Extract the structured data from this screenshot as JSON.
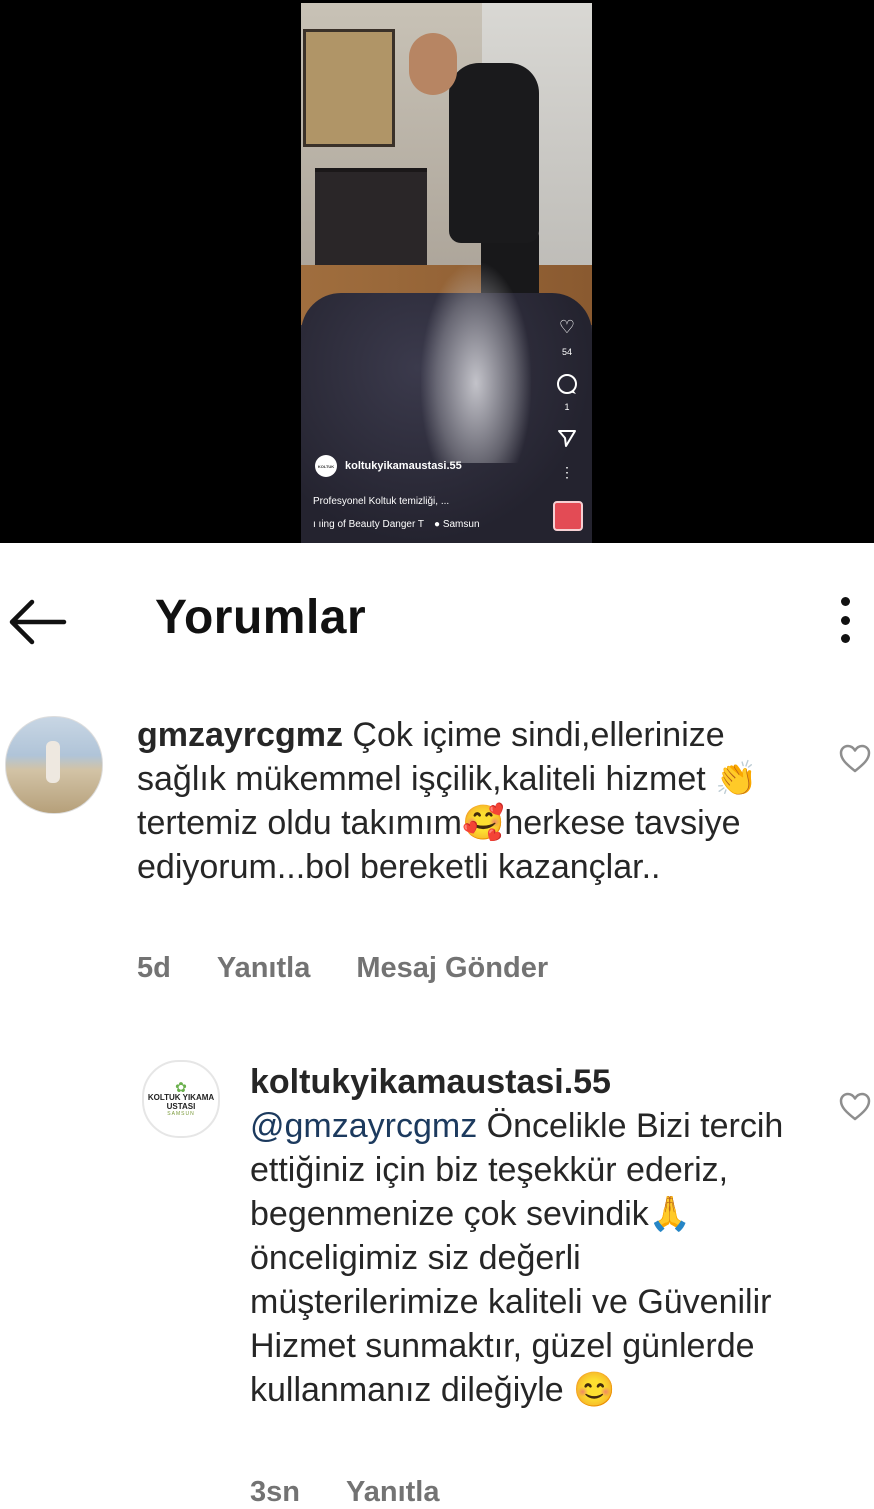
{
  "video": {
    "like_count": "54",
    "comment_count": "1",
    "username": "koltukyikamaustasi.55",
    "caption": "Profesyonel Koltuk temizliği, ...",
    "music": "ı ıing of Beauty   Danger T",
    "location": "Samsun"
  },
  "header": {
    "title": "Yorumlar"
  },
  "comments": [
    {
      "username": "gmzayrcgmz",
      "text_part1": "Çok içime sindi,ellerinize sağlık mükemmel işçilik,kaliteli hizmet ",
      "emoji1": "👏",
      "text_part2": "tertemiz oldu takımım",
      "emoji2": "🥰",
      "text_part3": "herkese tavsiye ediyorum...bol bereketli kazançlar..",
      "time": "5d",
      "reply_label": "Yanıtla",
      "message_label": "Mesaj Gönder"
    },
    {
      "username": "koltukyikamaustasi.55",
      "mention": "@gmzayrcgmz",
      "text_part1": " Öncelikle Bizi tercih ettiğiniz için biz teşekkür ederiz, begenmenize çok sevindik",
      "emoji1": "🙏",
      "text_part2": " önceligimiz siz değerli müşterilerimize kaliteli ve Güvenilir Hizmet sunmaktır, güzel günlerde kullanmanız dileğiyle ",
      "emoji2": "😊",
      "time": "3sn",
      "reply_label": "Yanıtla",
      "avatar_text_top": "KOLTUK YIKAMA USTASI",
      "avatar_text_bottom": "SAMSUN"
    }
  ],
  "colors": {
    "mention": "#1c3a5e",
    "meta_gray": "#737373"
  }
}
